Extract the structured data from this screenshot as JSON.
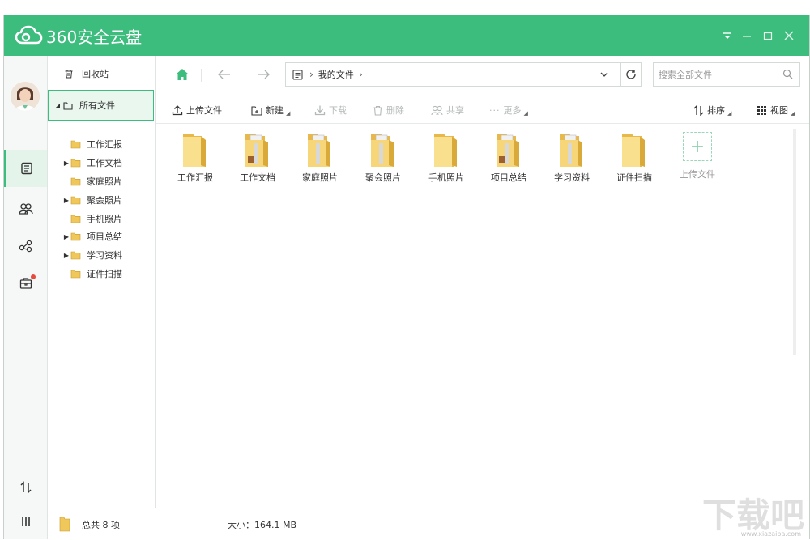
{
  "app": {
    "title": "360安全云盘",
    "accent": "#3dbd7d"
  },
  "window_controls": {
    "menu": "▾",
    "minimize": "–",
    "maximize": "□",
    "close": "✕"
  },
  "rail": {
    "items": [
      {
        "icon": "file-list-icon",
        "active": true
      },
      {
        "icon": "contacts-icon",
        "active": false
      },
      {
        "icon": "share-icon",
        "active": false
      },
      {
        "icon": "toolbox-icon",
        "active": false,
        "badge": true
      },
      {
        "icon": "transfer-icon",
        "active": false
      },
      {
        "icon": "menu-icon",
        "active": false
      }
    ]
  },
  "tree": {
    "recycle": "回收站",
    "all_files": "所有文件",
    "folders": [
      {
        "label": "工作汇报",
        "expandable": false
      },
      {
        "label": "工作文档",
        "expandable": true
      },
      {
        "label": "家庭照片",
        "expandable": false
      },
      {
        "label": "聚会照片",
        "expandable": true
      },
      {
        "label": "手机照片",
        "expandable": false
      },
      {
        "label": "项目总结",
        "expandable": true
      },
      {
        "label": "学习资料",
        "expandable": true
      },
      {
        "label": "证件扫描",
        "expandable": false
      }
    ]
  },
  "nav": {
    "breadcrumb": "我的文件",
    "search_placeholder": "搜索全部文件"
  },
  "toolbar": {
    "upload": "上传文件",
    "new": "新建",
    "download": "下载",
    "delete": "删除",
    "share": "共享",
    "more": "更多",
    "sort": "排序",
    "view": "视图"
  },
  "files": [
    {
      "name": "工作汇报",
      "type": "folder-plain"
    },
    {
      "name": "工作文档",
      "type": "folder-docs"
    },
    {
      "name": "家庭照片",
      "type": "folder-docs2"
    },
    {
      "name": "聚会照片",
      "type": "folder-docs2"
    },
    {
      "name": "手机照片",
      "type": "folder-plain"
    },
    {
      "name": "项目总结",
      "type": "folder-docs"
    },
    {
      "name": "学习资料",
      "type": "folder-docs2"
    },
    {
      "name": "证件扫描",
      "type": "folder-plain"
    }
  ],
  "upload_tile": "上传文件",
  "status": {
    "count": "总共 8 项",
    "size": "大小：164.1 MB"
  },
  "watermark": "下载吧",
  "watermark_url": "www.xiazaiba.com"
}
